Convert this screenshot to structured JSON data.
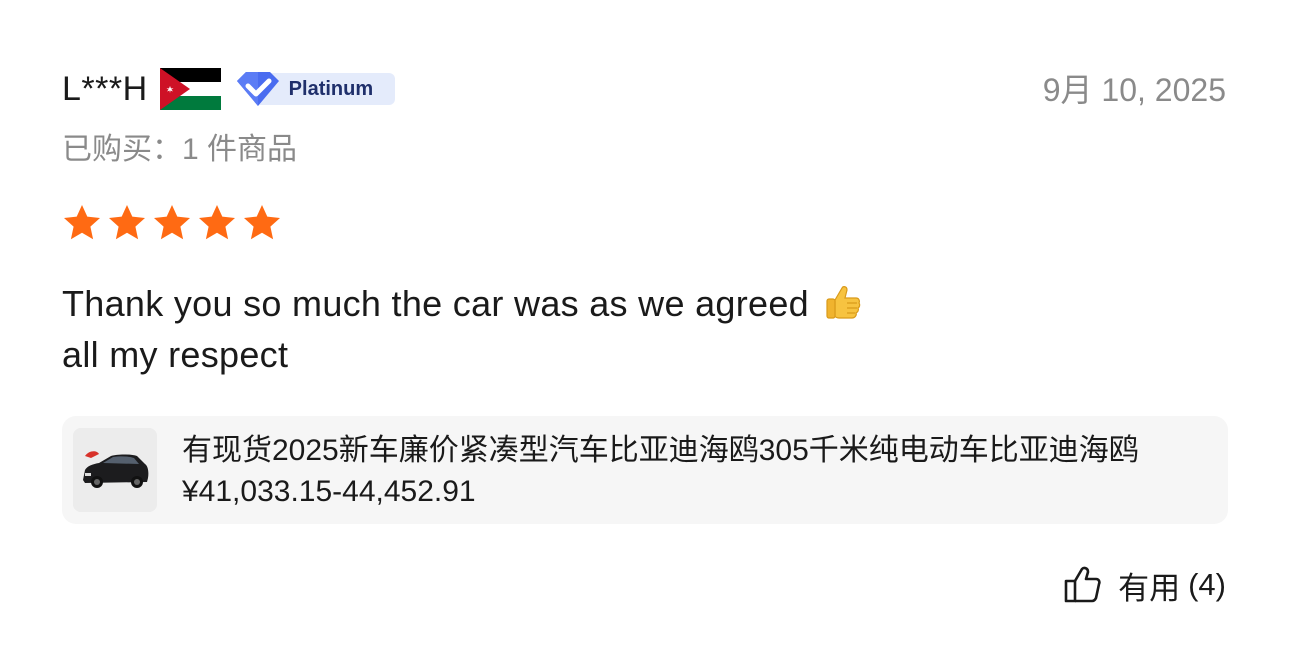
{
  "review": {
    "username": "L***H",
    "country_flag": "jordan-flag-icon",
    "badge": {
      "icon": "verified-diamond-icon",
      "label": "Platinum",
      "color": "#3b5bdb"
    },
    "date": "9月 10, 2025",
    "purchased": "已购买：1 件商品",
    "rating": 5,
    "rating_max": 5,
    "star_color": "#ff6a13",
    "text_line1": "Thank you so much the car was as we agreed",
    "text_emoji": "thumbs-up-emoji",
    "text_line2": "all my respect"
  },
  "product": {
    "title": "有现货2025新车廉价紧凑型汽车比亚迪海鸥305千米纯电动车比亚迪海鸥",
    "price": "¥41,033.15-44,452.91",
    "image": "black-car-thumbnail"
  },
  "helpful": {
    "icon": "thumbs-up-outline-icon",
    "label": "有用",
    "count": "(4)"
  }
}
